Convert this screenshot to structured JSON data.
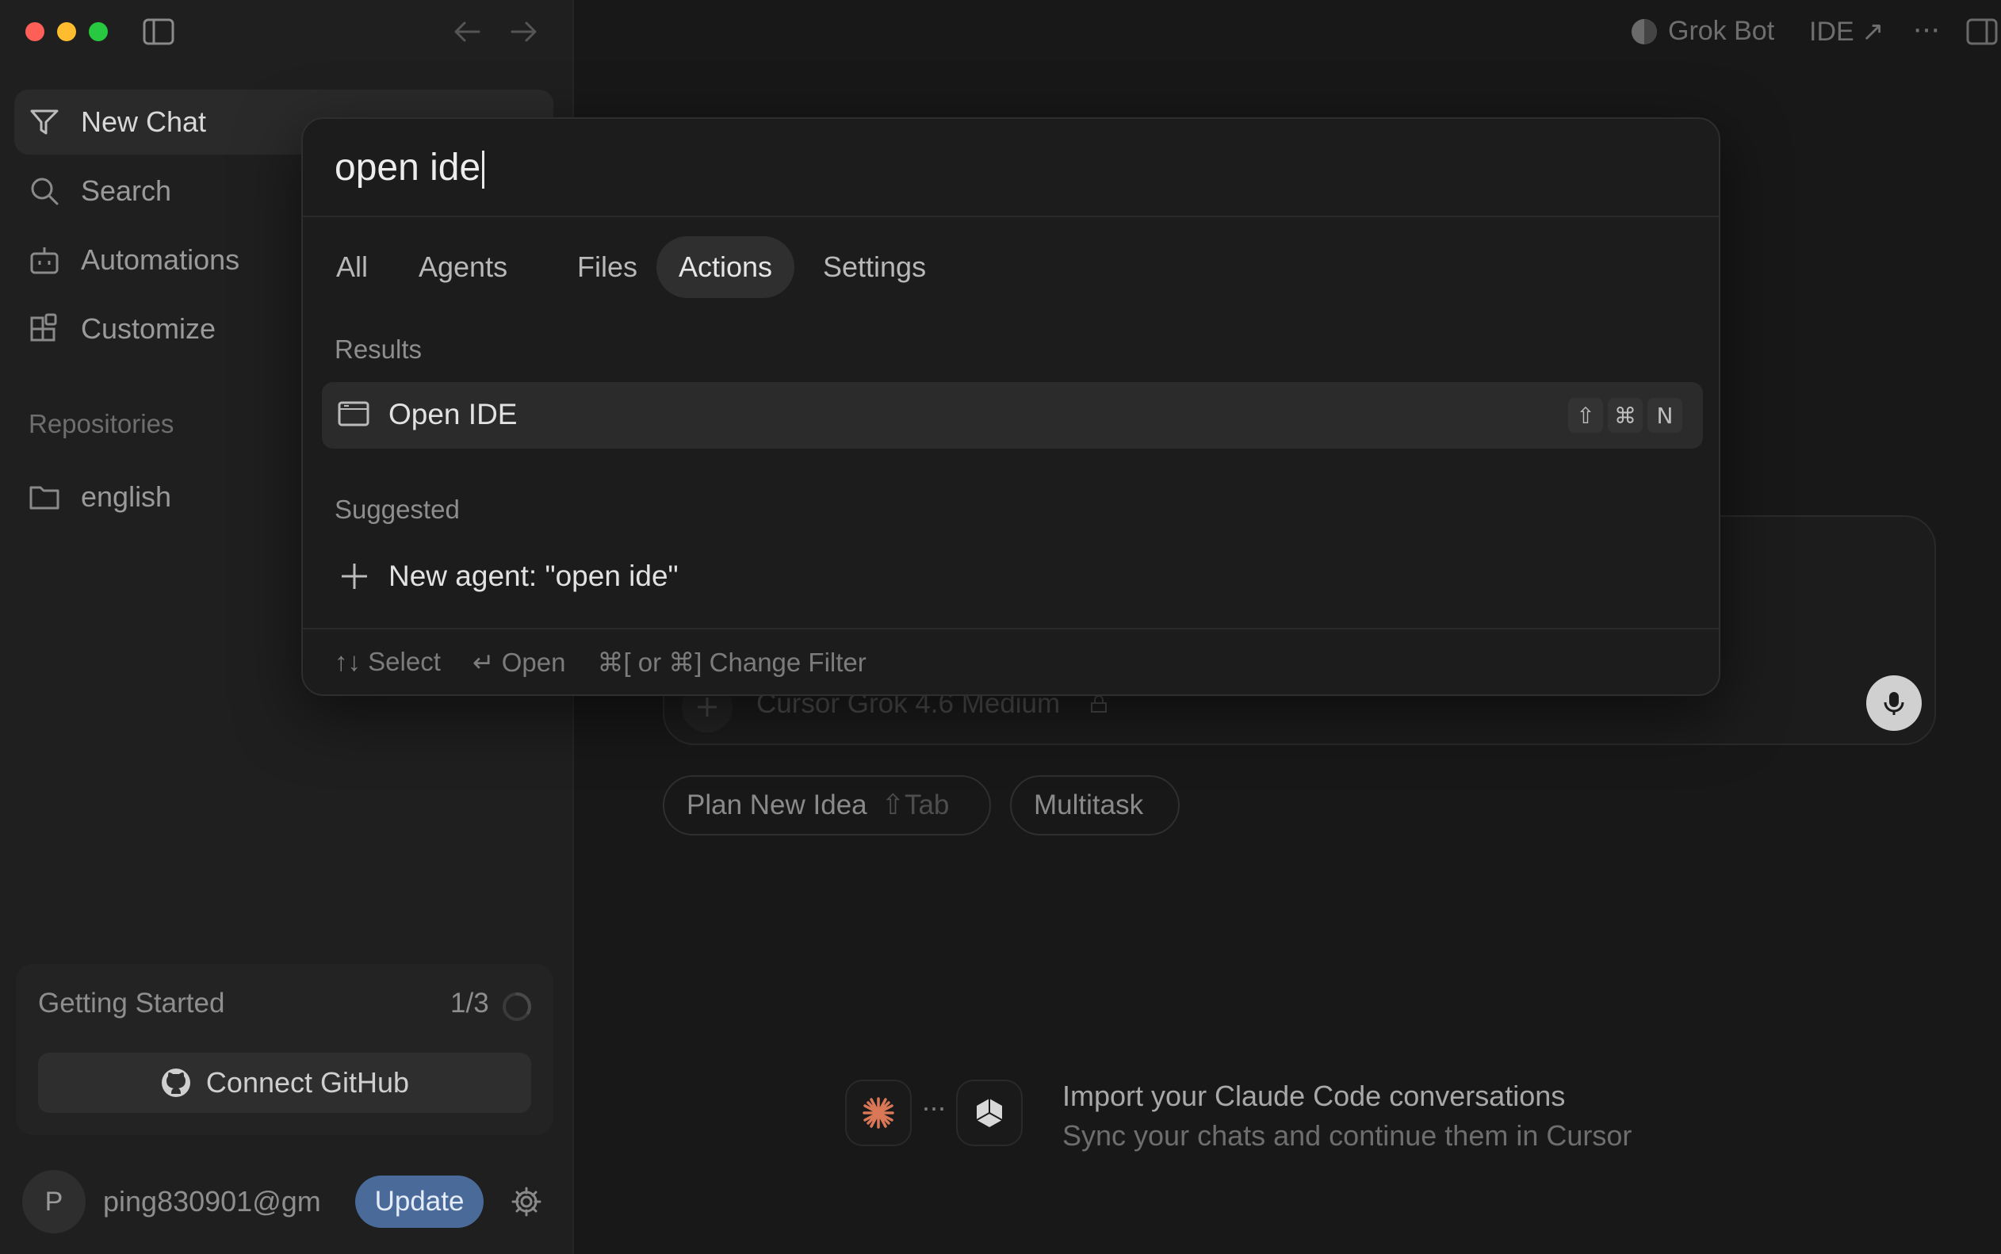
{
  "window": {
    "top_right": {
      "bot_label": "Grok Bot",
      "ide_label": "IDE ↗",
      "more_label": "···"
    }
  },
  "sidebar": {
    "nav": [
      {
        "label": "New Chat",
        "icon": "new-chat-icon"
      },
      {
        "label": "Search",
        "icon": "search-icon"
      },
      {
        "label": "Automations",
        "icon": "robot-icon"
      },
      {
        "label": "Customize",
        "icon": "blocks-icon"
      }
    ],
    "repositories_heading": "Repositories",
    "repositories": [
      {
        "label": "english",
        "icon": "folder-icon"
      }
    ],
    "getting_started": {
      "title": "Getting Started",
      "progress": "1/3",
      "progress_value": 0.33,
      "button": "Connect GitHub"
    },
    "user": {
      "avatar_letter": "P",
      "email": "ping830901@gm",
      "update_label": "Update"
    }
  },
  "main": {
    "composer": {
      "model_label": "Cursor Grok 4.6 Medium"
    },
    "chips": {
      "plan_label": "Plan New Idea",
      "plan_shortcut": "⇧Tab",
      "multitask_label": "Multitask"
    },
    "import_banner": {
      "title": "Import your Claude Code conversations",
      "subtitle": "Sync your chats and continue them in Cursor",
      "dots": "···"
    }
  },
  "palette": {
    "query": "open ide",
    "tabs": [
      "All",
      "Agents",
      "Files",
      "Actions",
      "Settings"
    ],
    "active_tab": "Actions",
    "results_heading": "Results",
    "results": [
      {
        "label": "Open IDE",
        "shortcut": [
          "⇧",
          "⌘",
          "N"
        ],
        "icon": "window-icon"
      }
    ],
    "suggested_heading": "Suggested",
    "suggested": [
      {
        "label": "New agent: \"open ide\"",
        "icon": "plus-icon"
      }
    ],
    "footer": [
      {
        "keys": "↑↓",
        "label": "Select"
      },
      {
        "keys": "↵",
        "label": "Open"
      },
      {
        "keys": "⌘[ or ⌘]",
        "label": "Change Filter"
      }
    ]
  },
  "colors": {
    "background": "#181818",
    "sidebar": "#1f1f1f",
    "palette": "#1c1c1c",
    "update_button": "#4a6a9a",
    "close": "#fe5f57",
    "minimize": "#febc2e",
    "maximize": "#28c840",
    "claude_accent": "#d97757"
  }
}
